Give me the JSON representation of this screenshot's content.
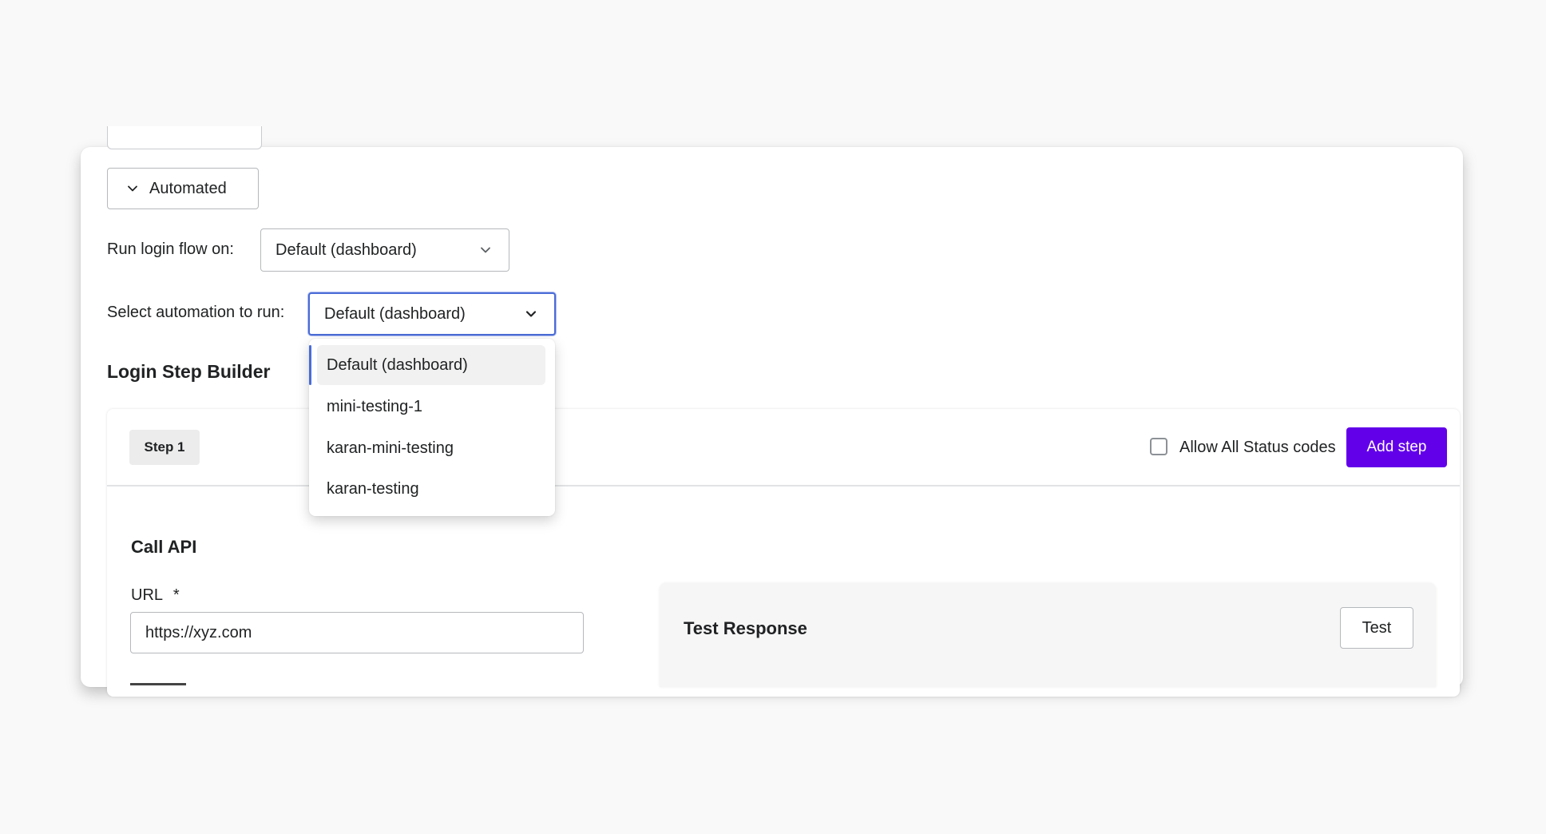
{
  "mode_toggle": {
    "label": "Automated"
  },
  "login_flow": {
    "label": "Run login flow on:",
    "selected": "Default (dashboard)"
  },
  "automation": {
    "label": "Select automation to run:",
    "selected": "Default (dashboard)",
    "options": [
      "Default (dashboard)",
      "mini-testing-1",
      "karan-mini-testing",
      "karan-testing"
    ]
  },
  "builder": {
    "title": "Login Step Builder",
    "step_label": "Step 1",
    "allow_status_label": "Allow All Status codes",
    "add_step_label": "Add step"
  },
  "call_api": {
    "title": "Call API",
    "url_label": "URL",
    "url_required": "*",
    "url_value": "https://xyz.com"
  },
  "test_response": {
    "title": "Test Response",
    "test_label": "Test"
  },
  "colors": {
    "primary": "#6200ea",
    "focus": "#4a6cd6"
  }
}
